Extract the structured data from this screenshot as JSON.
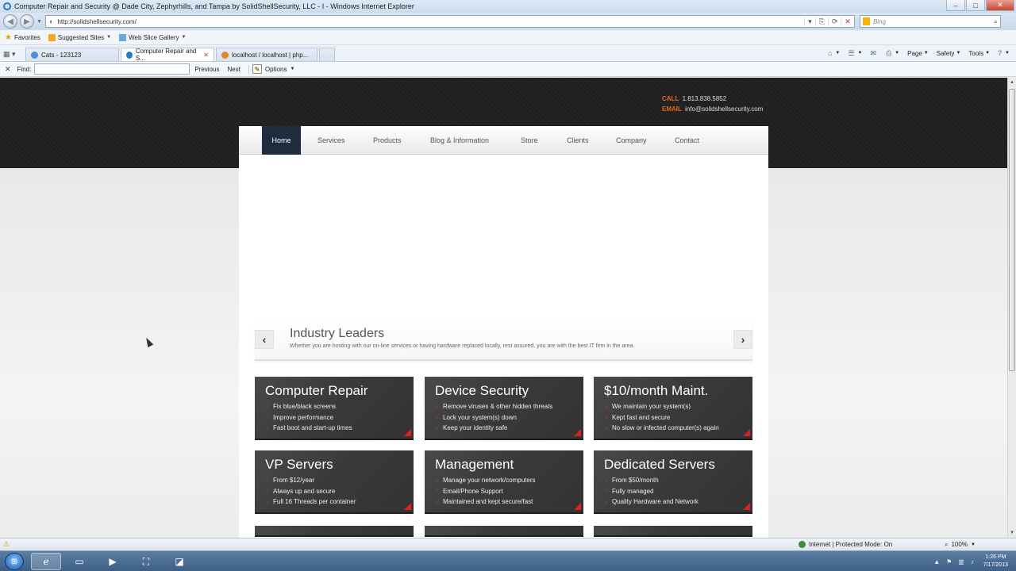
{
  "browser": {
    "window_title": "Computer Repair and Security @ Dade City, Zephyrhills, and Tampa by SolidShellSecurity, LLC - I - Windows Internet Explorer",
    "url": "http://solidshellsecurity.com/",
    "search_placeholder": "Bing",
    "favorites_label": "Favorites",
    "favorites_items": [
      "Suggested Sites",
      "Web Slice Gallery"
    ],
    "tabs": [
      {
        "label": "Cats - 123123"
      },
      {
        "label": "Computer Repair and S..."
      },
      {
        "label": "localhost / localhost | php..."
      }
    ],
    "commands": [
      "Page",
      "Safety",
      "Tools"
    ],
    "find": {
      "label": "Find:",
      "previous": "Previous",
      "next": "Next",
      "options": "Options"
    },
    "status": {
      "zone": "Internet | Protected Mode: On",
      "zoom": "100%"
    }
  },
  "site": {
    "contact": {
      "call_label": "CALL",
      "call_value": "1.813.838.5852",
      "email_label": "EMAIL",
      "email_value": "info@solidshellsecurity.com"
    },
    "nav": [
      "Home",
      "Services",
      "Products",
      "Blog & Information",
      "Store",
      "Clients",
      "Company",
      "Contact"
    ],
    "slider": {
      "title": "Industry Leaders",
      "description": "Whether you are hosting with our on-line services or having hardware replaced locally, rest assured, you are with the best IT firm in the area."
    },
    "cards": [
      {
        "title": "Computer Repair",
        "items": [
          "Fix blue/black screens",
          "Improve performance",
          "Fast boot and start-up times"
        ]
      },
      {
        "title": "Device Security",
        "items": [
          "Remove viruses & other hidden threats",
          "Lock your system(s) down",
          "Keep your identity safe"
        ]
      },
      {
        "title": "$10/month Maint.",
        "items": [
          "We maintain your system(s)",
          "Kept fast and secure",
          "No slow or infected computer(s) again"
        ]
      },
      {
        "title": "VP Servers",
        "items": [
          "From $12/year",
          "Always up and secure",
          "Full 16 Threads per container"
        ]
      },
      {
        "title": "Management",
        "items": [
          "Manage your network/computers",
          "Email/Phone Support",
          "Maintained and kept secure/fast"
        ]
      },
      {
        "title": "Dedicated Servers",
        "items": [
          "From $50/month",
          "Fully managed",
          "Quality Hardware and Network"
        ]
      }
    ]
  },
  "taskbar": {
    "time": "1:26 PM",
    "date": "7/17/2013"
  }
}
